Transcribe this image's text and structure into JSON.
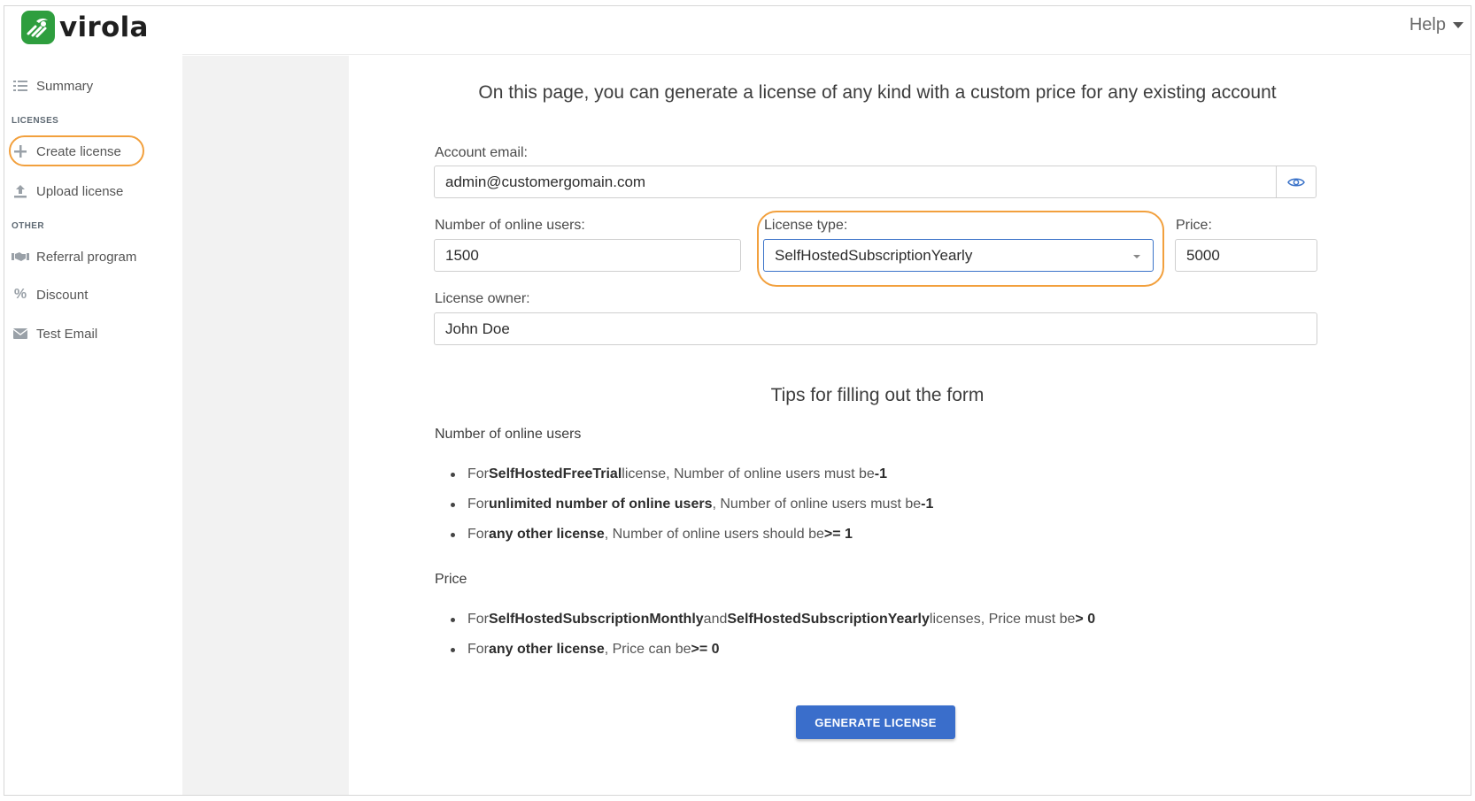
{
  "app": {
    "brand": "virola",
    "brand_color": "#2e9e3e",
    "accent": "#3a6ecb",
    "highlight": "#f2a03d"
  },
  "header": {
    "help_label": "Help"
  },
  "sidebar": {
    "summary": {
      "label": "Summary",
      "icon": "list-icon"
    },
    "section_licenses": "LICENSES",
    "create_license": {
      "label": "Create license",
      "icon": "plus-icon",
      "active": true
    },
    "upload_license": {
      "label": "Upload license",
      "icon": "upload-icon"
    },
    "section_other": "OTHER",
    "referral": {
      "label": "Referral program",
      "icon": "handshake-icon"
    },
    "discount": {
      "label": "Discount",
      "icon": "percent-icon"
    },
    "test_email": {
      "label": "Test Email",
      "icon": "envelope-icon"
    }
  },
  "form": {
    "title": "On this page, you can generate a license of any kind with a custom price for any existing account",
    "email_label": "Account email:",
    "email_value": "admin@customergomain.com",
    "users_label": "Number of online users:",
    "users_value": "1500",
    "type_label": "License type:",
    "type_value": "SelfHostedSubscriptionYearly",
    "price_label": "Price:",
    "price_value": "5000",
    "owner_label": "License owner:",
    "owner_value": "John Doe",
    "submit_label": "GENERATE LICENSE"
  },
  "tips": {
    "title": "Tips for filling out the form",
    "users_heading": "Number of online users",
    "users_rules": [
      {
        "pre": "For ",
        "bold": "SelfHostedFreeTrial",
        "mid": " license, Number of online users must be ",
        "bold2": "-1"
      },
      {
        "pre": "For ",
        "bold": "unlimited number of online users",
        "mid": ", Number of online users must be ",
        "bold2": "-1"
      },
      {
        "pre": "For ",
        "bold": "any other license",
        "mid": ", Number of online users should be ",
        "bold2": ">= 1"
      }
    ],
    "price_heading": "Price",
    "price_rules": [
      {
        "pre": "For ",
        "bold": "SelfHostedSubscriptionMonthly",
        "mid": " and ",
        "bold2": "SelfHostedSubscriptionYearly",
        "post": " licenses, Price must be ",
        "bold3": "> 0"
      },
      {
        "pre": "For ",
        "bold": "any other license",
        "mid": ", Price can be ",
        "bold2": ">= 0"
      }
    ]
  }
}
